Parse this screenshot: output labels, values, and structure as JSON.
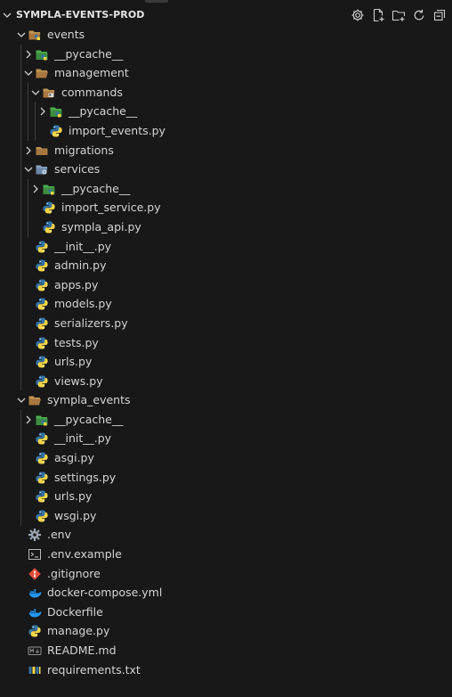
{
  "explorer": {
    "title": "SYMPLA-EVENTS-PROD",
    "actions": [
      {
        "name": "settings-icon"
      },
      {
        "name": "new-file-icon"
      },
      {
        "name": "new-folder-icon"
      },
      {
        "name": "refresh-icon"
      },
      {
        "name": "collapse-all-icon"
      }
    ]
  },
  "tree": [
    {
      "label": "events",
      "depth": 0,
      "type": "folder",
      "open": true,
      "icon": "python-folder"
    },
    {
      "label": "__pycache__",
      "depth": 1,
      "type": "folder",
      "open": false,
      "icon": "pycache-folder"
    },
    {
      "label": "management",
      "depth": 1,
      "type": "folder",
      "open": true,
      "icon": "folder-open"
    },
    {
      "label": "commands",
      "depth": 2,
      "type": "folder",
      "open": true,
      "icon": "commands-folder"
    },
    {
      "label": "__pycache__",
      "depth": 3,
      "type": "folder",
      "open": false,
      "icon": "pycache-folder"
    },
    {
      "label": "import_events.py",
      "depth": 3,
      "type": "file",
      "icon": "python"
    },
    {
      "label": "migrations",
      "depth": 1,
      "type": "folder",
      "open": false,
      "icon": "folder"
    },
    {
      "label": "services",
      "depth": 1,
      "type": "folder",
      "open": true,
      "icon": "services-folder"
    },
    {
      "label": "__pycache__",
      "depth": 2,
      "type": "folder",
      "open": false,
      "icon": "pycache-folder"
    },
    {
      "label": "import_service.py",
      "depth": 2,
      "type": "file",
      "icon": "python"
    },
    {
      "label": "sympla_api.py",
      "depth": 2,
      "type": "file",
      "icon": "python"
    },
    {
      "label": "__init__.py",
      "depth": 1,
      "type": "file",
      "icon": "python"
    },
    {
      "label": "admin.py",
      "depth": 1,
      "type": "file",
      "icon": "python"
    },
    {
      "label": "apps.py",
      "depth": 1,
      "type": "file",
      "icon": "python"
    },
    {
      "label": "models.py",
      "depth": 1,
      "type": "file",
      "icon": "python"
    },
    {
      "label": "serializers.py",
      "depth": 1,
      "type": "file",
      "icon": "python"
    },
    {
      "label": "tests.py",
      "depth": 1,
      "type": "file",
      "icon": "python"
    },
    {
      "label": "urls.py",
      "depth": 1,
      "type": "file",
      "icon": "python"
    },
    {
      "label": "views.py",
      "depth": 1,
      "type": "file",
      "icon": "python"
    },
    {
      "label": "sympla_events",
      "depth": 0,
      "type": "folder",
      "open": true,
      "icon": "folder-open"
    },
    {
      "label": "__pycache__",
      "depth": 1,
      "type": "folder",
      "open": false,
      "icon": "pycache-folder"
    },
    {
      "label": "__init__.py",
      "depth": 1,
      "type": "file",
      "icon": "python"
    },
    {
      "label": "asgi.py",
      "depth": 1,
      "type": "file",
      "icon": "python"
    },
    {
      "label": "settings.py",
      "depth": 1,
      "type": "file",
      "icon": "python"
    },
    {
      "label": "urls.py",
      "depth": 1,
      "type": "file",
      "icon": "python"
    },
    {
      "label": "wsgi.py",
      "depth": 1,
      "type": "file",
      "icon": "python"
    },
    {
      "label": ".env",
      "depth": 0,
      "type": "file",
      "icon": "gear"
    },
    {
      "label": ".env.example",
      "depth": 0,
      "type": "file",
      "icon": "terminal"
    },
    {
      "label": ".gitignore",
      "depth": 0,
      "type": "file",
      "icon": "git"
    },
    {
      "label": "docker-compose.yml",
      "depth": 0,
      "type": "file",
      "icon": "docker"
    },
    {
      "label": "Dockerfile",
      "depth": 0,
      "type": "file",
      "icon": "docker"
    },
    {
      "label": "manage.py",
      "depth": 0,
      "type": "file",
      "icon": "python"
    },
    {
      "label": "README.md",
      "depth": 0,
      "type": "file",
      "icon": "markdown"
    },
    {
      "label": "requirements.txt",
      "depth": 0,
      "type": "file",
      "icon": "requirements"
    }
  ],
  "colors": {
    "background": "#181818",
    "text": "#cccccc",
    "folder": "#c09553",
    "python_blue": "#3572a5",
    "python_yellow": "#f5d547",
    "pycache_green": "#4cae4f",
    "git_red": "#e44d3a",
    "docker_blue": "#2496ed"
  }
}
